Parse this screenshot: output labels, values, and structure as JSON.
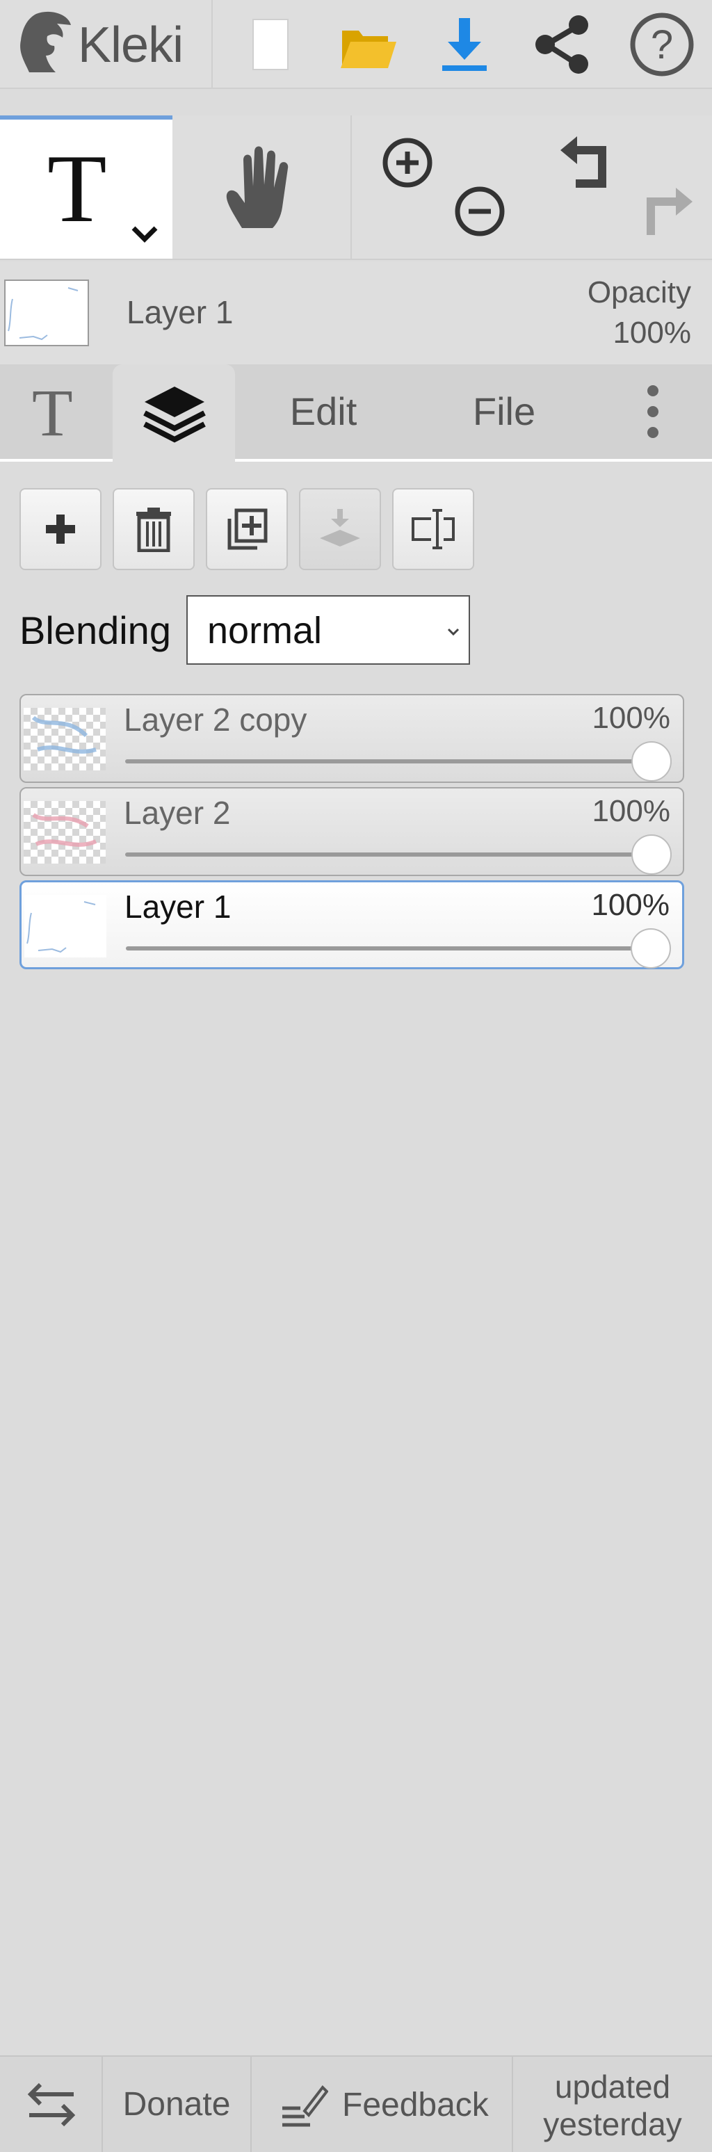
{
  "app": {
    "name": "Kleki"
  },
  "layer_header": {
    "current_layer_name": "Layer 1",
    "opacity_label": "Opacity",
    "opacity_value": "100%"
  },
  "tabs": {
    "edit": "Edit",
    "file": "File"
  },
  "layers_panel": {
    "blending_label": "Blending",
    "blending_value": "normal",
    "layers": [
      {
        "name": "Layer 2 copy",
        "opacity": "100%",
        "opacity_fraction": 1.0,
        "active": false
      },
      {
        "name": "Layer 2",
        "opacity": "100%",
        "opacity_fraction": 1.0,
        "active": false
      },
      {
        "name": "Layer 1",
        "opacity": "100%",
        "opacity_fraction": 1.0,
        "active": true
      }
    ]
  },
  "footer": {
    "donate": "Donate",
    "feedback": "Feedback",
    "updated_line1": "updated",
    "updated_line2": "yesterday"
  },
  "colors": {
    "accent": "#6fa0dc",
    "download": "#1e88e5",
    "folder": "#f3c02c"
  },
  "icons": [
    "kleki-logo-icon",
    "new-file-icon",
    "open-folder-icon",
    "download-icon",
    "share-icon",
    "help-icon",
    "text-tool-icon",
    "hand-tool-icon",
    "zoom-in-icon",
    "zoom-out-icon",
    "undo-icon",
    "redo-icon",
    "layers-icon",
    "more-icon",
    "add-layer-icon",
    "delete-layer-icon",
    "duplicate-layer-icon",
    "merge-down-icon",
    "rename-layer-icon",
    "swap-icon",
    "feedback-icon"
  ]
}
